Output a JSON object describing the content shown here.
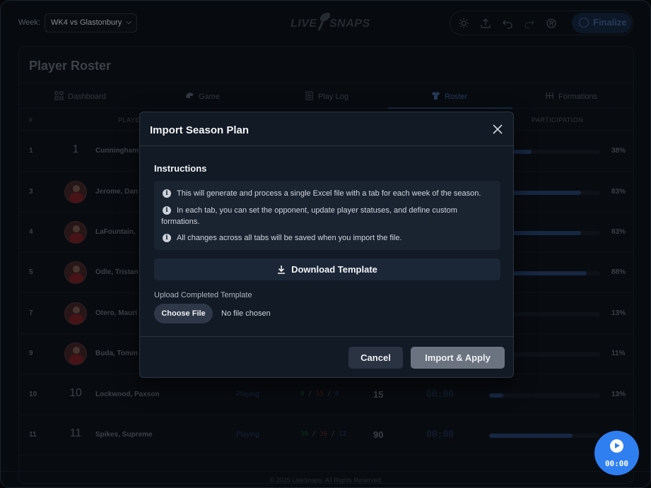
{
  "header": {
    "week_label": "Week:",
    "week_selected": "WK4 vs Glastonbury",
    "logo_part1": "LIVE",
    "logo_part2": "SNAPS",
    "finalize_label": "Finalize"
  },
  "roster": {
    "title": "Player Roster",
    "tabs": [
      {
        "label": "Dashboard",
        "icon": "dashboard-icon"
      },
      {
        "label": "Game",
        "icon": "helmet-icon"
      },
      {
        "label": "Play Log",
        "icon": "clipboard-icon"
      },
      {
        "label": "Roster",
        "icon": "jersey-icon",
        "active": true
      },
      {
        "label": "Formations",
        "icon": "formation-icon"
      }
    ],
    "columns": {
      "num": "#",
      "player": "PLAYER",
      "participation": "PARTICIPATION"
    },
    "rows": [
      {
        "num": "1",
        "jersey": "1",
        "name": "Cunningham,",
        "pct": "38%",
        "participation": 0.38,
        "has_avatar": false
      },
      {
        "num": "3",
        "jersey": "",
        "name": "Jerome, Dan",
        "pct": "83%",
        "participation": 0.83,
        "has_avatar": true
      },
      {
        "num": "4",
        "jersey": "",
        "name": "LaFountain,",
        "pct": "83%",
        "participation": 0.83,
        "has_avatar": true
      },
      {
        "num": "5",
        "jersey": "",
        "name": "Odle, Tristan",
        "pct": "88%",
        "participation": 0.88,
        "has_avatar": true
      },
      {
        "num": "7",
        "jersey": "",
        "name": "Otero, Mauri",
        "pct": "13%",
        "participation": 0.13,
        "has_avatar": true
      },
      {
        "num": "9",
        "jersey": "",
        "name": "Buda, Tomm",
        "pct": "11%",
        "participation": 0.11,
        "has_avatar": true
      },
      {
        "num": "10",
        "jersey": "10",
        "name": "Lockwood, Paxson",
        "status": "Playing",
        "snaps_g": "0",
        "snaps_r": "15",
        "snaps_b": "0",
        "total": "15",
        "time": "00:00",
        "pct": "13%",
        "participation": 0.13,
        "has_avatar": false
      },
      {
        "num": "11",
        "jersey": "11",
        "name": "Spikes, Supreme",
        "status": "Playing",
        "snaps_g": "39",
        "snaps_r": "39",
        "snaps_b": "12",
        "total": "90",
        "time": "00:00",
        "pct": "",
        "participation": 0.75,
        "has_avatar": false
      }
    ]
  },
  "modal": {
    "title": "Import Season Plan",
    "instructions_title": "Instructions",
    "instructions": [
      "This will generate and process a single Excel file with a tab for each week of the season.",
      "In each tab, you can set the opponent, update player statuses, and define custom formations.",
      "All changes across all tabs will be saved when you import the file."
    ],
    "download_label": "Download Template",
    "upload_label": "Upload Completed Template",
    "choose_file_label": "Choose File",
    "no_file_text": "No file chosen",
    "cancel_label": "Cancel",
    "apply_label": "Import & Apply"
  },
  "timer": {
    "time": "00:00"
  },
  "footer": {
    "text": "© 2025 LiveSnaps. All Rights Reserved."
  },
  "colors": {
    "accent": "#2f7ff1",
    "modal_bg": "#111a25",
    "apply_disabled": "#6a737f"
  }
}
